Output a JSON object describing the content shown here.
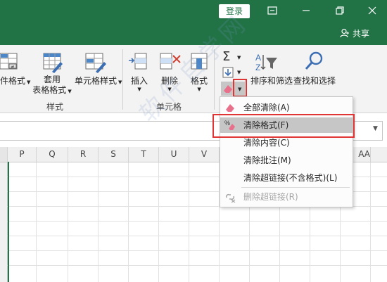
{
  "titlebar": {
    "login_label": "登录",
    "share_label": "共享"
  },
  "ribbon": {
    "cond_format_label": "件格式",
    "table_format_line1": "套用",
    "table_format_line2": "表格格式",
    "cell_style_label": "单元格样式",
    "styles_group": "样式",
    "insert_label": "插入",
    "delete_label": "删除",
    "format_label": "格式",
    "cells_group": "单元格",
    "sort_filter_label": "排序和筛选",
    "find_select_label": "查找和选择"
  },
  "sheet": {
    "columns": [
      "P",
      "Q",
      "R",
      "S",
      "T",
      "U",
      "V",
      "AA"
    ]
  },
  "clear_menu": {
    "items": [
      {
        "label": "全部清除(A)",
        "icon": "eraser-icon",
        "disabled": false
      },
      {
        "label": "清除格式(F)",
        "icon": "clear-format-icon",
        "disabled": false,
        "highlighted": true
      },
      {
        "label": "清除内容(C)",
        "icon": "",
        "disabled": false
      },
      {
        "label": "清除批注(M)",
        "icon": "",
        "disabled": false
      },
      {
        "label": "清除超链接(不含格式)(L)",
        "icon": "",
        "disabled": false
      },
      {
        "label": "删除超链接(R)",
        "icon": "remove-link-icon",
        "disabled": true
      }
    ]
  },
  "colors": {
    "excel_green": "#217346",
    "highlight_red": "#e03535"
  }
}
